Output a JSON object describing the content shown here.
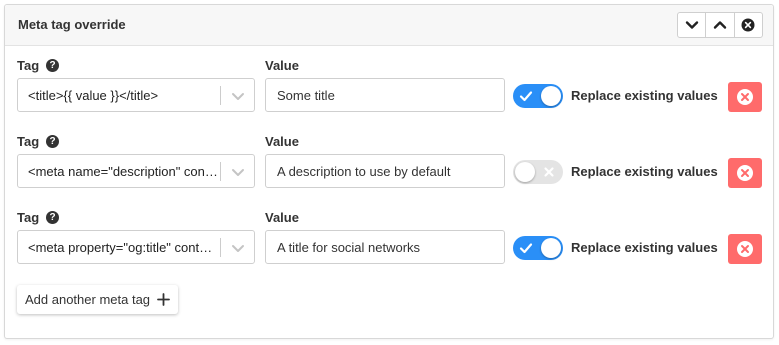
{
  "panel": {
    "title": "Meta tag override",
    "controls": [
      {
        "icon": "chevron-down-icon"
      },
      {
        "icon": "chevron-up-icon"
      },
      {
        "icon": "close-circle-icon"
      }
    ]
  },
  "labels": {
    "tag": "Tag",
    "value": "Value",
    "help": "?",
    "replace": "Replace existing values"
  },
  "rows": [
    {
      "tag": "<title>{{ value }}</title>",
      "value": "Some title",
      "replace": true
    },
    {
      "tag": "<meta name=\"description\" con…",
      "value": "A description to use by default",
      "replace": false
    },
    {
      "tag": "<meta property=\"og:title\" cont…",
      "value": "A title for social networks",
      "replace": true
    }
  ],
  "add_button": {
    "label": "Add another meta tag",
    "icon": "plus-icon"
  },
  "colors": {
    "accent": "#2a8ff7",
    "danger": "#ff6b6b"
  }
}
